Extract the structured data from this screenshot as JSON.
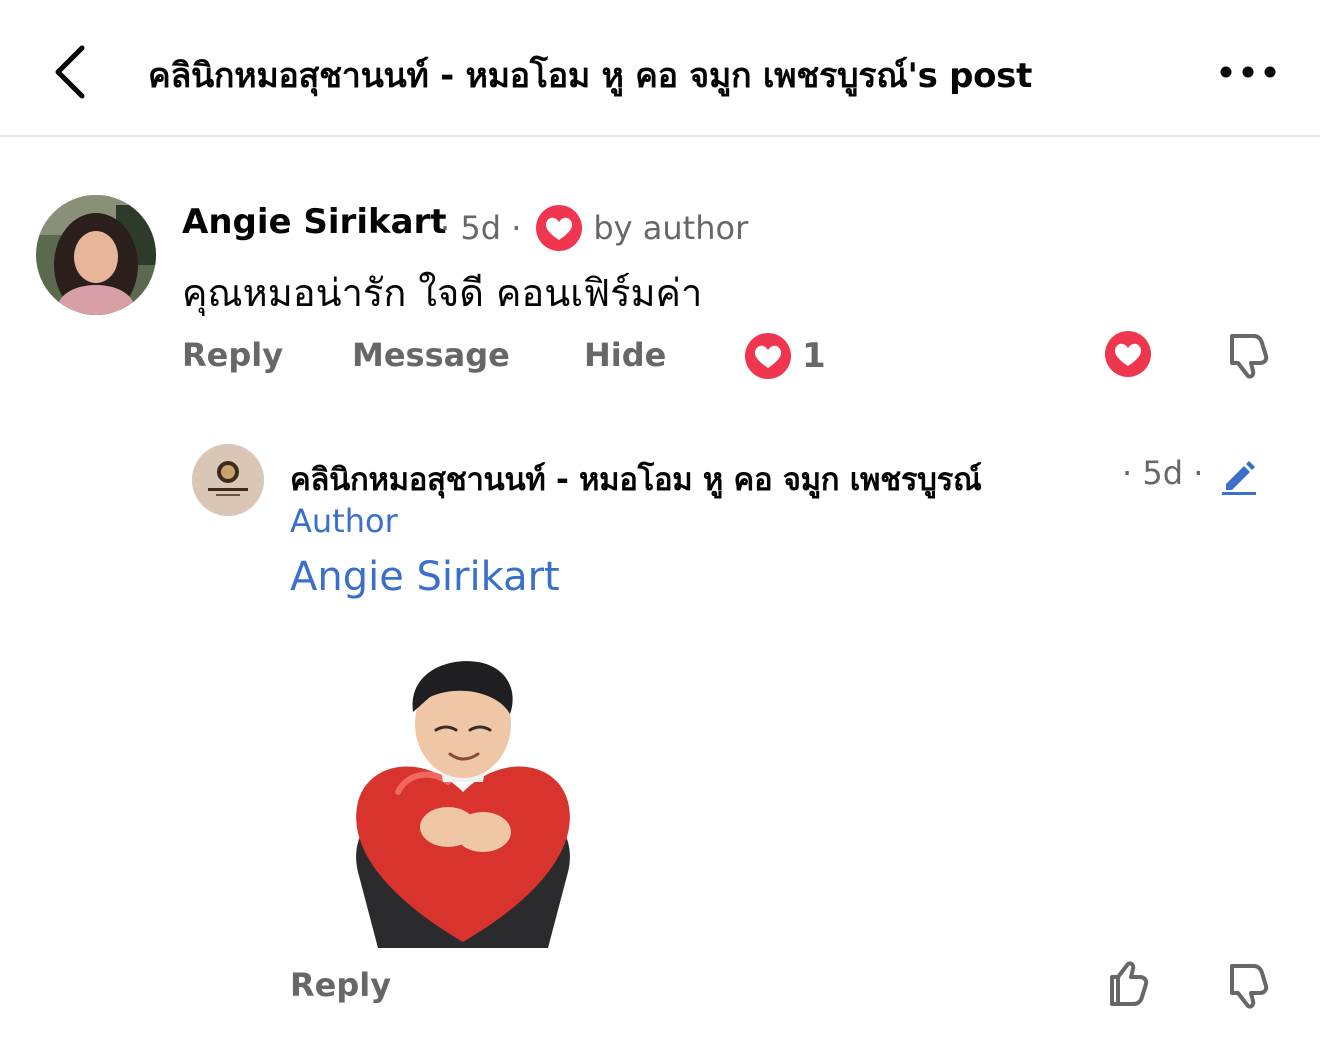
{
  "header": {
    "title": "คลินิกหมอสุชานนท์ - หมอโอม หู คอ จมูก เพชรบูรณ์'s post",
    "back_icon": "chevron-left-icon",
    "more_icon": "more-horizontal-icon"
  },
  "comment": {
    "author": "Angie Sirikart",
    "time": "· 5d ·",
    "badge_text": "by author",
    "text": "คุณหมอน่ารัก ใจดี คอนเฟิร์มค่า",
    "actions": {
      "reply": "Reply",
      "message": "Message",
      "hide": "Hide"
    },
    "reaction_count": "1",
    "colors": {
      "love": "#f0364f",
      "meta": "#65676b"
    }
  },
  "reply": {
    "author": "คลินิกหมอสุชานนท์ - หมอโอม หู คอ จมูก เพชรบูรณ์",
    "time": "· 5d ·",
    "role": "Author",
    "mention": "Angie Sirikart",
    "sticker_icon": "heart-hug-sticker",
    "actions": {
      "reply": "Reply"
    },
    "colors": {
      "link": "#3a70cc"
    }
  }
}
